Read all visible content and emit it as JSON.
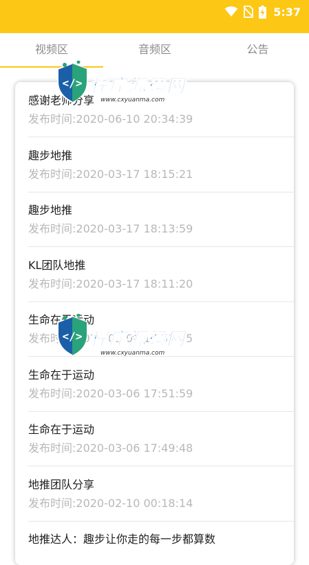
{
  "status_bar": {
    "time": "5:37",
    "background_color": "#fcc715",
    "icons": [
      "wifi-icon",
      "no-sim-icon",
      "battery-charging-icon"
    ]
  },
  "tabs": [
    {
      "label": "视频区",
      "selected": true
    },
    {
      "label": "音频区",
      "selected": false
    },
    {
      "label": "公告",
      "selected": false
    }
  ],
  "list": {
    "items": [
      {
        "title": "感谢老师分享",
        "time": "发布时间:2020-06-10 20:34:39"
      },
      {
        "title": "趣步地推",
        "time": "发布时间:2020-03-17 18:15:21"
      },
      {
        "title": "趣步地推",
        "time": "发布时间:2020-03-17 18:13:59"
      },
      {
        "title": "KL团队地推",
        "time": "发布时间:2020-03-17 18:11:20"
      },
      {
        "title": "生命在于运动",
        "time": "发布时间:2020-03-06 17:51:45"
      },
      {
        "title": "生命在于运动",
        "time": "发布时间:2020-03-06 17:51:59"
      },
      {
        "title": "生命在于运动",
        "time": "发布时间:2020-03-06 17:49:48"
      },
      {
        "title": "地推团队分享",
        "time": "发布时间:2020-02-10 00:18:14"
      },
      {
        "title": "地推达人：趣步让你走的每一步都算数",
        "time": ""
      }
    ]
  },
  "watermark": {
    "text": "程序源码网",
    "url": "www.cxyuanma.com"
  }
}
